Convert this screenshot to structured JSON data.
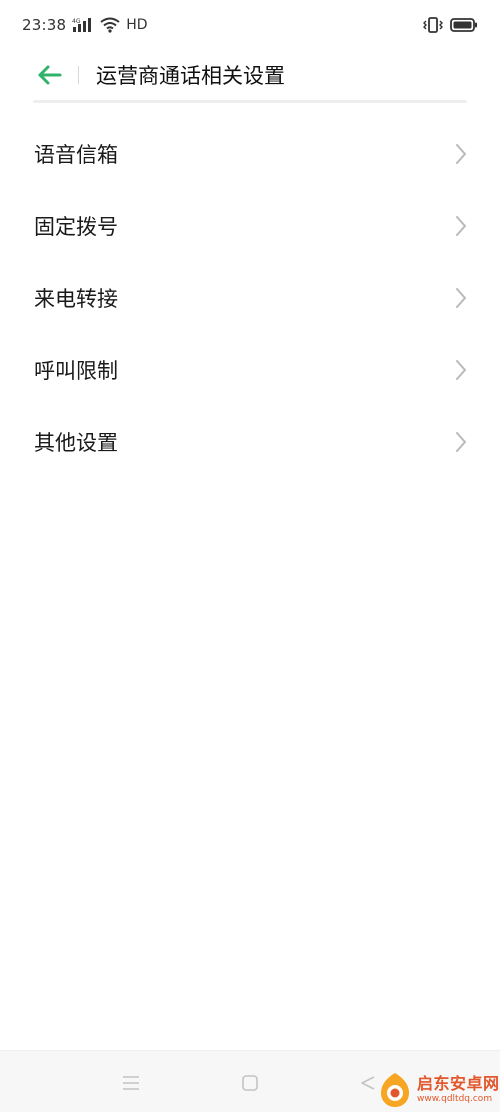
{
  "status_bar": {
    "time": "23:38",
    "network_label": "4G",
    "hd_label": "HD",
    "icons": [
      "signal-icon",
      "wifi-icon",
      "vibrate-icon",
      "battery-icon"
    ]
  },
  "header": {
    "title": "运营商通话相关设置",
    "back_icon": "back-arrow-icon",
    "accent_color": "#2fb36a"
  },
  "settings": {
    "items": [
      {
        "label": "语音信箱"
      },
      {
        "label": "固定拨号"
      },
      {
        "label": "来电转接"
      },
      {
        "label": "呼叫限制"
      },
      {
        "label": "其他设置"
      }
    ]
  },
  "nav_bar": {
    "icons": [
      "menu-icon",
      "home-icon",
      "back-icon"
    ]
  },
  "watermark": {
    "name": "启东安卓网",
    "url": "www.qdltdq.com"
  }
}
